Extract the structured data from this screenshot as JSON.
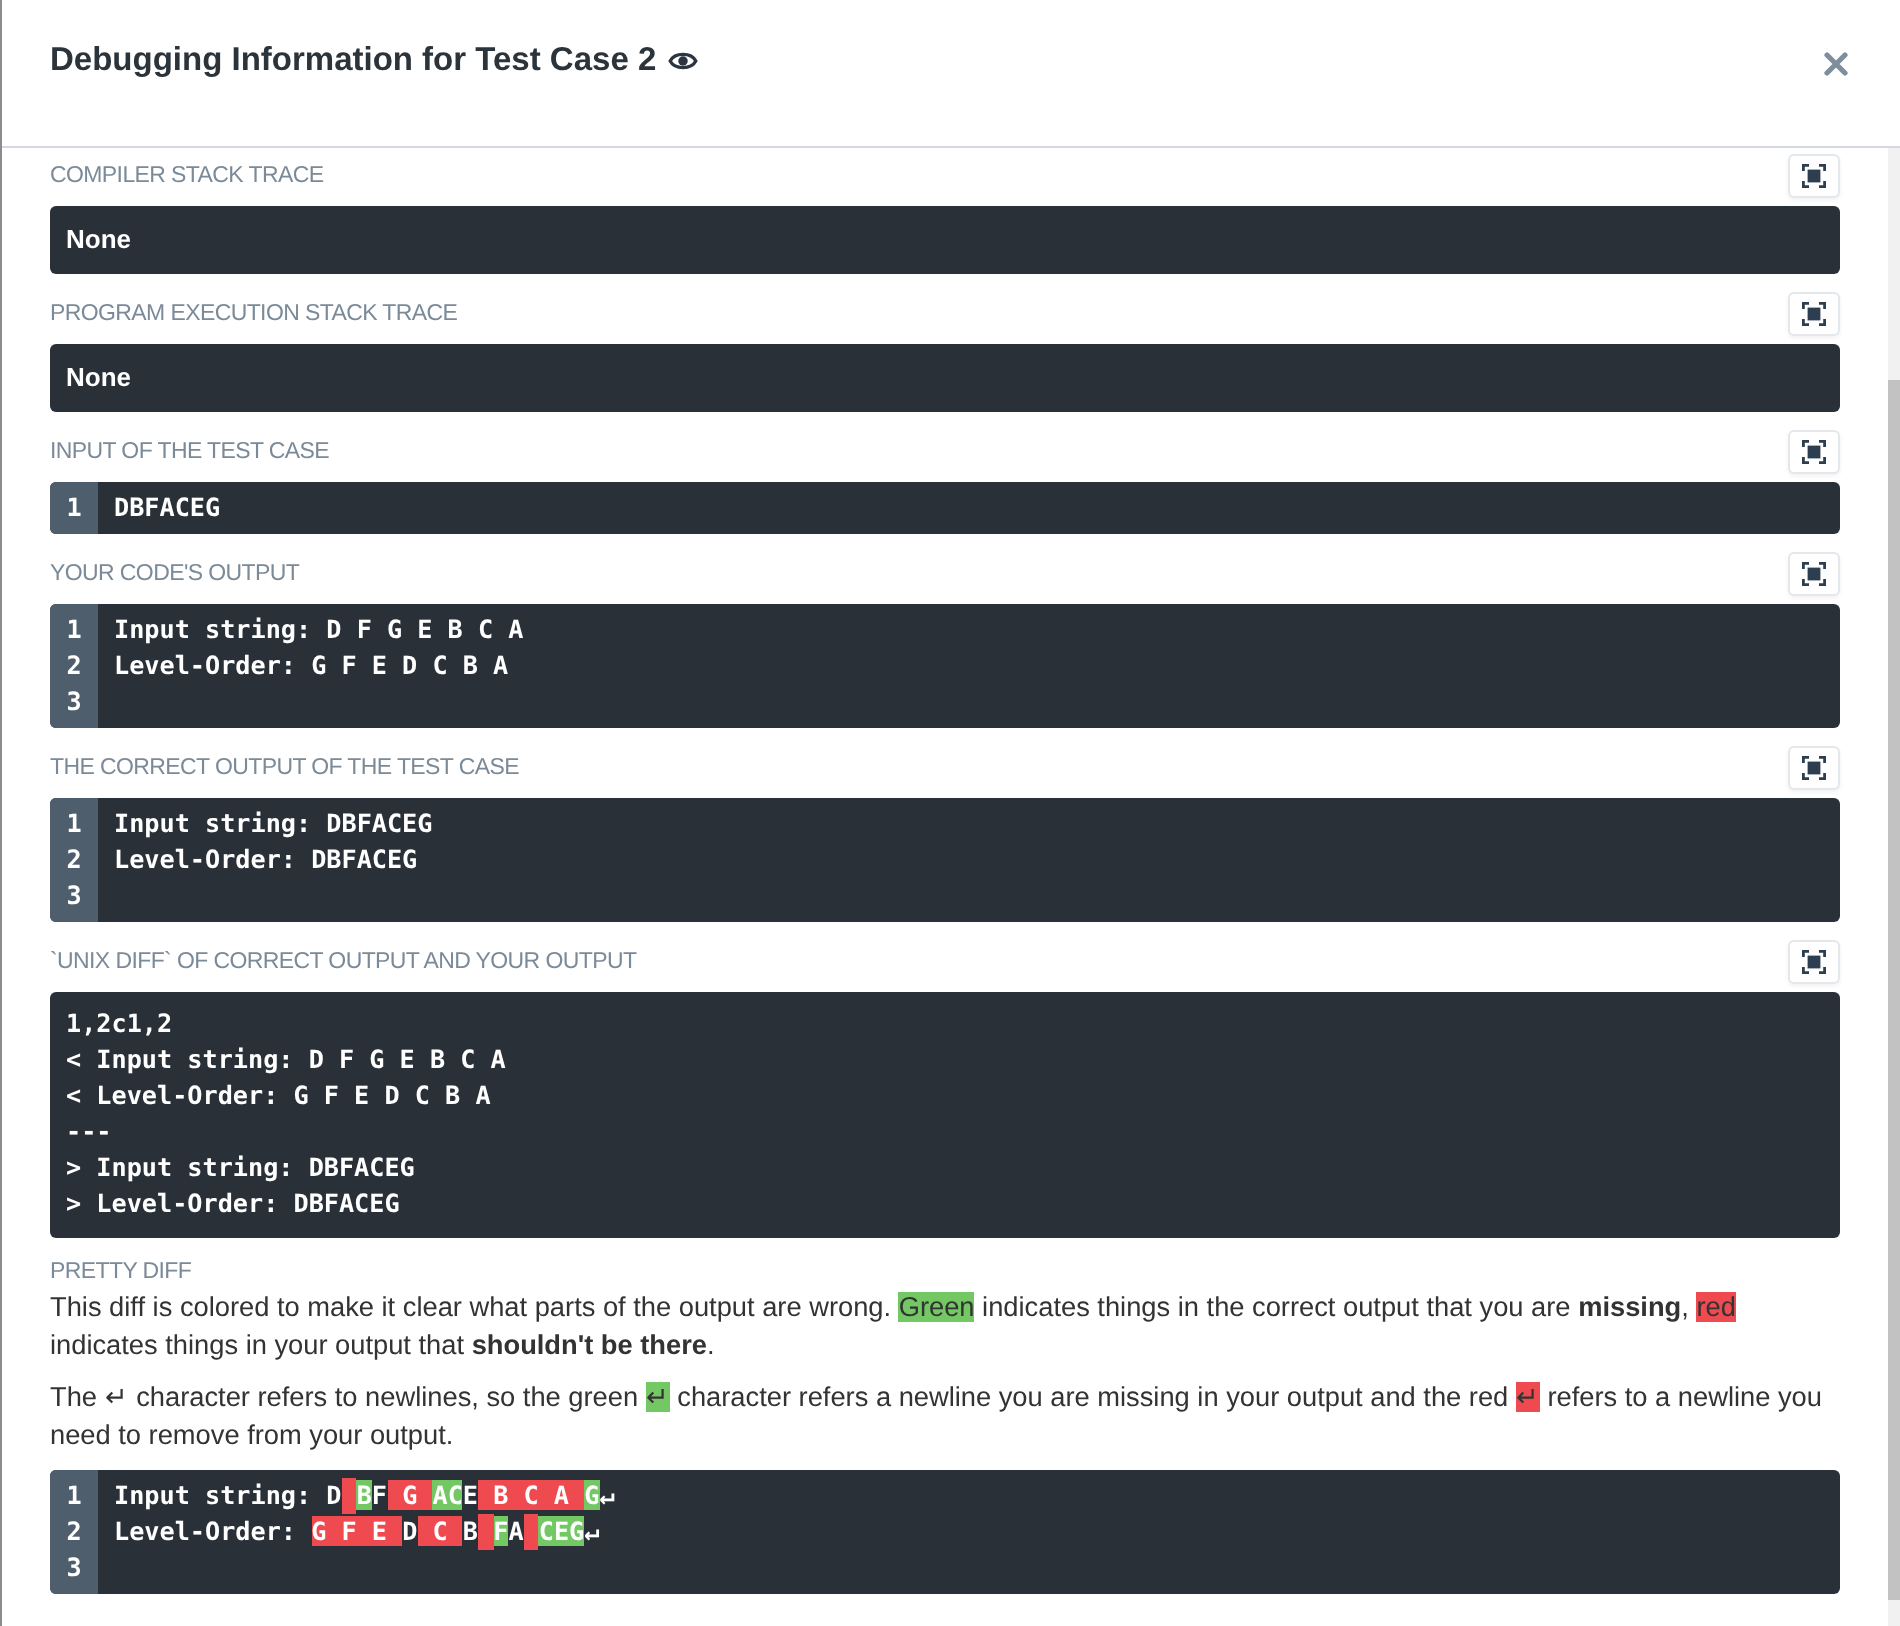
{
  "dialog": {
    "title": "Debugging Information for Test Case 2"
  },
  "sections": [
    {
      "kind": "text",
      "label": "COMPILER STACK TRACE",
      "expandable": true,
      "text": "None"
    },
    {
      "kind": "text",
      "label": "PROGRAM EXECUTION STACK TRACE",
      "expandable": true,
      "text": "None"
    },
    {
      "kind": "numbered",
      "label": "INPUT OF THE TEST CASE",
      "expandable": true,
      "lines": [
        {
          "number": "1",
          "text": "DBFACEG"
        }
      ]
    },
    {
      "kind": "numbered",
      "label": "YOUR CODE'S OUTPUT",
      "expandable": true,
      "lines": [
        {
          "number": "1",
          "text": "Input string: D F G E B C A"
        },
        {
          "number": "2",
          "text": "Level-Order: G F E D C B A"
        },
        {
          "number": "3"
        }
      ]
    },
    {
      "kind": "numbered",
      "label": "THE CORRECT OUTPUT OF THE TEST CASE",
      "expandable": true,
      "lines": [
        {
          "number": "1",
          "text": "Input string: DBFACEG"
        },
        {
          "number": "2",
          "text": "Level-Order: DBFACEG"
        },
        {
          "number": "3"
        }
      ]
    },
    {
      "kind": "plain",
      "label": "`UNIX DIFF` OF CORRECT OUTPUT AND YOUR OUTPUT",
      "expandable": true,
      "lines": [
        "1,2c1,2",
        "< Input string: D F G E B C A",
        "< Level-Order: G F E D C B A",
        "---",
        "> Input string: DBFACEG",
        "> Level-Order: DBFACEG"
      ]
    },
    {
      "kind": "pretty",
      "label": "PRETTY DIFF",
      "expandable": false,
      "paragraphs": [
        [
          {
            "kind": "plain",
            "text": "This diff is colored to make it clear what parts of the output are wrong. "
          },
          {
            "kind": "added",
            "text": "Green"
          },
          {
            "kind": "plain",
            "text": " indicates things in the correct output that you are "
          },
          {
            "kind": "bold",
            "text": "missing"
          },
          {
            "kind": "plain",
            "text": ", "
          },
          {
            "kind": "removed",
            "text": "red"
          },
          {
            "kind": "plain",
            "text": " indicates things in your output that "
          },
          {
            "kind": "bold",
            "text": "shouldn't be there"
          },
          {
            "kind": "plain",
            "text": "."
          }
        ],
        [
          {
            "kind": "plain",
            "text": "The ↵ character refers to newlines, so the green "
          },
          {
            "kind": "added",
            "text": "↵"
          },
          {
            "kind": "plain",
            "text": " character refers a newline you are missing in your output and the red "
          },
          {
            "kind": "removed",
            "text": "↵"
          },
          {
            "kind": "plain",
            "text": " refers to a newline you need to remove from your output."
          }
        ]
      ],
      "lines": [
        {
          "number": "1",
          "segments": [
            {
              "kind": "plain",
              "text": "Input string: D"
            },
            {
              "kind": "removed-space"
            },
            {
              "kind": "added",
              "text": "B"
            },
            {
              "kind": "plain",
              "text": "F"
            },
            {
              "kind": "removed",
              "text": " G "
            },
            {
              "kind": "added",
              "text": "AC"
            },
            {
              "kind": "plain",
              "text": "E"
            },
            {
              "kind": "removed",
              "text": " B C A "
            },
            {
              "kind": "added",
              "text": "G"
            },
            {
              "kind": "plain",
              "text": "↵"
            }
          ]
        },
        {
          "number": "2",
          "segments": [
            {
              "kind": "plain",
              "text": "Level-Order: "
            },
            {
              "kind": "removed",
              "text": "G F E "
            },
            {
              "kind": "plain",
              "text": "D"
            },
            {
              "kind": "removed",
              "text": " C "
            },
            {
              "kind": "plain",
              "text": "B"
            },
            {
              "kind": "removed-space"
            },
            {
              "kind": "added",
              "text": "F"
            },
            {
              "kind": "plain",
              "text": "A"
            },
            {
              "kind": "removed-space"
            },
            {
              "kind": "added",
              "text": "CEG"
            },
            {
              "kind": "plain",
              "text": "↵"
            }
          ]
        },
        {
          "number": "3"
        }
      ]
    }
  ]
}
